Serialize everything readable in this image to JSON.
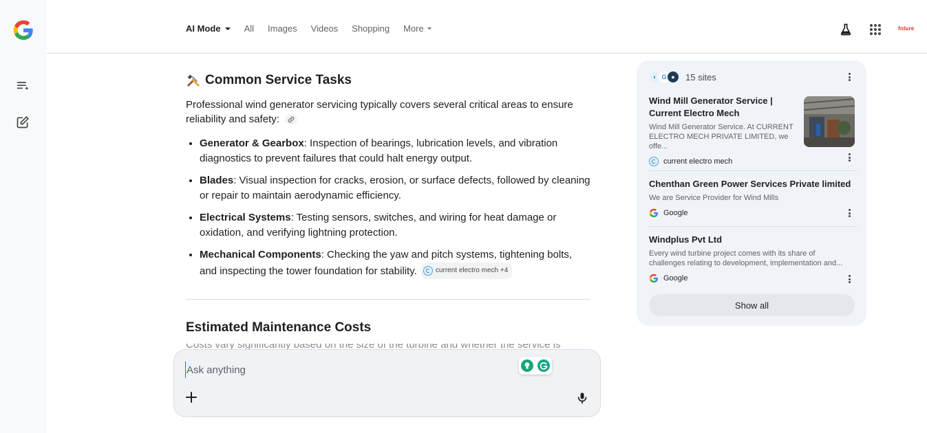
{
  "nav": {
    "tabs": [
      {
        "label": "AI Mode"
      },
      {
        "label": "All"
      },
      {
        "label": "Images"
      },
      {
        "label": "Videos"
      },
      {
        "label": "Shopping"
      },
      {
        "label": "More"
      }
    ],
    "brand_badge": "fnlure"
  },
  "article": {
    "section_title": "Common Service Tasks",
    "intro": "Professional wind generator servicing typically covers several critical areas to ensure reliability and safety:",
    "tasks": [
      {
        "term": "Generator & Gearbox",
        "text": ": Inspection of bearings, lubrication levels, and vibration diagnostics to prevent failures that could halt energy output."
      },
      {
        "term": "Blades",
        "text": ": Visual inspection for cracks, erosion, or surface defects, followed by cleaning or repair to maintain aerodynamic efficiency."
      },
      {
        "term": "Electrical Systems",
        "text": ": Testing sensors, switches, and wiring for heat damage or oxidation, and verifying lightning protection."
      },
      {
        "term": "Mechanical Components",
        "text": ": Checking the yaw and pitch systems, tightening bolts, and inspecting the tower foundation for stability."
      }
    ],
    "citation_chip": "current electro mech +4",
    "next_section_title": "Estimated Maintenance Costs",
    "next_section_partial": "Costs vary significantly based on the size of the turbine and whether the service is"
  },
  "ask": {
    "placeholder": "Ask anything"
  },
  "sources": {
    "count_label": "15 sites",
    "items": [
      {
        "title": "Wind Mill Generator Service | Current Electro Mech",
        "snippet": "Wind Mill Generator Service. At CURRENT ELECTRO MECH PRIVATE LIMITED, we offe...",
        "publisher": "current electro mech"
      },
      {
        "title": "Chenthan Green Power Services Private limited",
        "snippet": "We are Service Provider for Wind Mills",
        "publisher": "Google"
      },
      {
        "title": "Windplus Pvt Ltd",
        "snippet": "Every wind turbine project comes with its share of challenges relating to development, implementation and...",
        "publisher": "Google"
      }
    ],
    "show_all_label": "Show all"
  },
  "colors": {
    "accent": "#1a73e8",
    "panel_bg": "#f0f4f9",
    "ask_bg": "#f0f2f5"
  }
}
